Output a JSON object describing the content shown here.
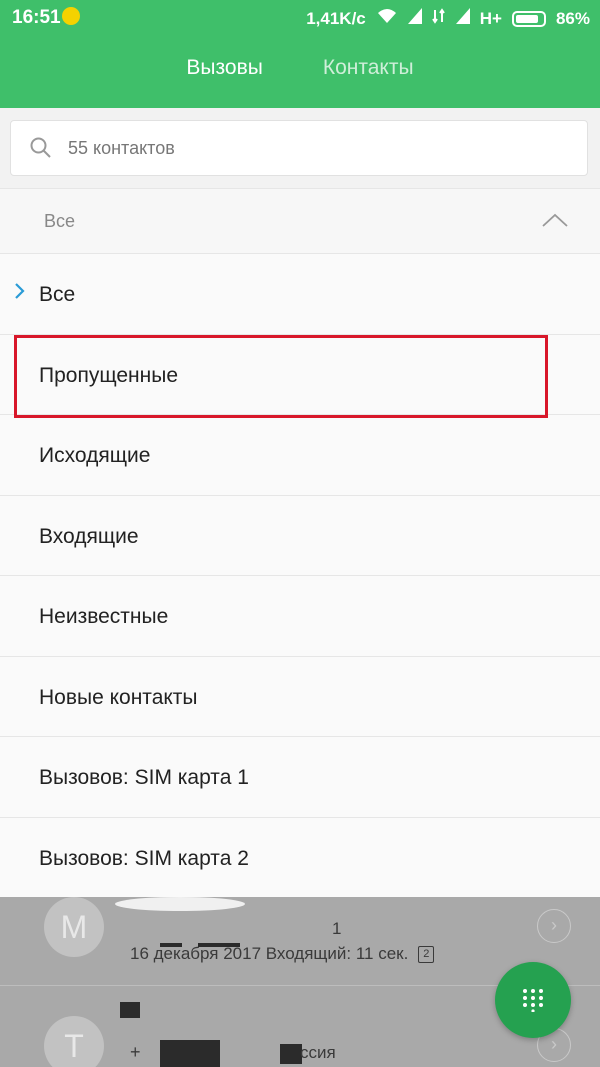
{
  "status_bar": {
    "time": "16:51",
    "speed": "1,41K/c",
    "network": "H+",
    "battery": "86%",
    "battery_level": 0.86
  },
  "tabs": [
    {
      "label": "Вызовы",
      "active": true
    },
    {
      "label": "Контакты",
      "active": false
    }
  ],
  "search": {
    "placeholder": "55 контактов",
    "icon": "search-icon"
  },
  "filter": {
    "current": "Все",
    "options": [
      {
        "label": "Все",
        "selected": true
      },
      {
        "label": "Пропущенные",
        "selected": false,
        "highlighted": true
      },
      {
        "label": "Исходящие",
        "selected": false
      },
      {
        "label": "Входящие",
        "selected": false
      },
      {
        "label": "Неизвестные",
        "selected": false
      },
      {
        "label": "Новые контакты",
        "selected": false
      },
      {
        "label": "Вызовов: SIM карта 1",
        "selected": false
      },
      {
        "label": "Вызовов: SIM карта 2",
        "selected": false
      }
    ]
  },
  "call_log": [
    {
      "avatar": "M",
      "name_fragment": "1",
      "detail": "16 декабря 2017 Входящий: 11 сек.",
      "sim": "2"
    },
    {
      "avatar": "T",
      "detail_fragment": "ссия",
      "prefix": "+"
    }
  ],
  "colors": {
    "header_green": "#3fbf6a",
    "fab_green": "#25a150",
    "highlight_red": "#d8172a",
    "check_blue": "#2a9bd6"
  }
}
